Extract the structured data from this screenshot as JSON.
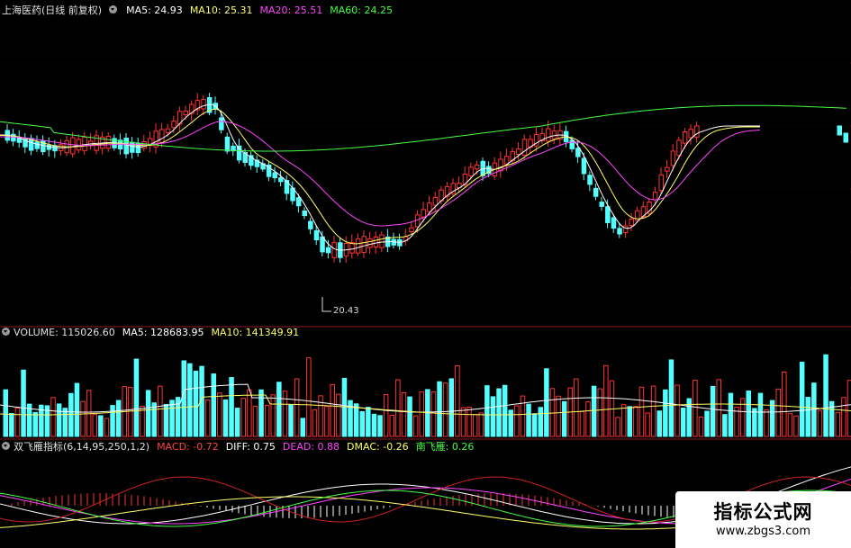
{
  "price_panel": {
    "title": "上海医药(日线 前复权)",
    "ma5": "MA5: 24.93",
    "ma10": "MA10: 25.31",
    "ma20": "MA20: 25.51",
    "ma60": "MA60: 24.25",
    "low_label": "20.43",
    "colors": {
      "ma5": "#ffffff",
      "ma10": "#ffff66",
      "ma20": "#ff44ff",
      "ma60": "#44ff44",
      "up": "#ff3232",
      "down": "#54ffff"
    }
  },
  "volume_panel": {
    "volume": "VOLUME: 115026.60",
    "ma5": "MA5: 128683.95",
    "ma10": "MA10: 141349.91"
  },
  "indicator_panel": {
    "name": "双飞雁指标(6,14,95,250,1,2)",
    "macd": "MACD: -0.72",
    "diff": "DIFF: 0.75",
    "dead": "DEAD: 0.88",
    "dmac": "DMAC: -0.26",
    "nanfeiyan": "南飞雁: 0.26"
  },
  "watermark": {
    "title": "指标公式网",
    "url": "www.zbgs3.com"
  }
}
